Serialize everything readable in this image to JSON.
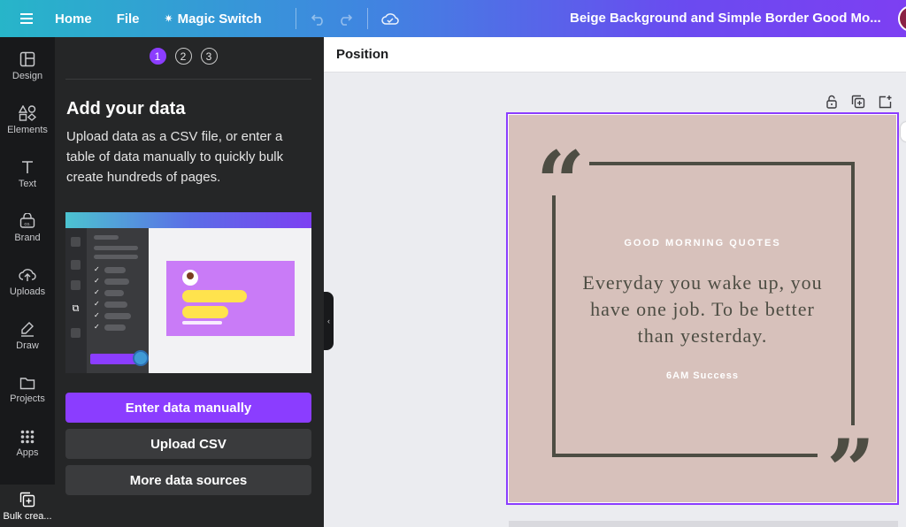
{
  "topbar": {
    "home": "Home",
    "file": "File",
    "magic_switch": "Magic Switch",
    "design_title": "Beige Background and Simple Border Good Mo..."
  },
  "rail": {
    "items": [
      {
        "label": "Design",
        "icon": "layout-icon"
      },
      {
        "label": "Elements",
        "icon": "shapes-icon"
      },
      {
        "label": "Text",
        "icon": "text-icon"
      },
      {
        "label": "Brand",
        "icon": "brand-icon"
      },
      {
        "label": "Uploads",
        "icon": "upload-icon"
      },
      {
        "label": "Draw",
        "icon": "draw-icon"
      },
      {
        "label": "Projects",
        "icon": "folder-icon"
      },
      {
        "label": "Apps",
        "icon": "apps-icon"
      },
      {
        "label": "Bulk crea...",
        "icon": "bulk-create-icon"
      }
    ]
  },
  "panel": {
    "steps": [
      "1",
      "2",
      "3"
    ],
    "active_step": 1,
    "title": "Add your data",
    "description": "Upload data as a CSV file, or enter a table of data manually to quickly bulk create hundreds of pages.",
    "buttons": {
      "enter_manually": "Enter data manually",
      "upload_csv": "Upload CSV",
      "more_sources": "More data sources"
    }
  },
  "editor": {
    "header_label": "Position"
  },
  "design": {
    "eyebrow": "GOOD MORNING QUOTES",
    "quote": "Everyday you wake up, you have one job. To be better than yesterday.",
    "author": "6AM Success",
    "background_color": "#d7c1bb",
    "accent_color": "#4d4d43",
    "selection_color": "#8b3dff"
  }
}
